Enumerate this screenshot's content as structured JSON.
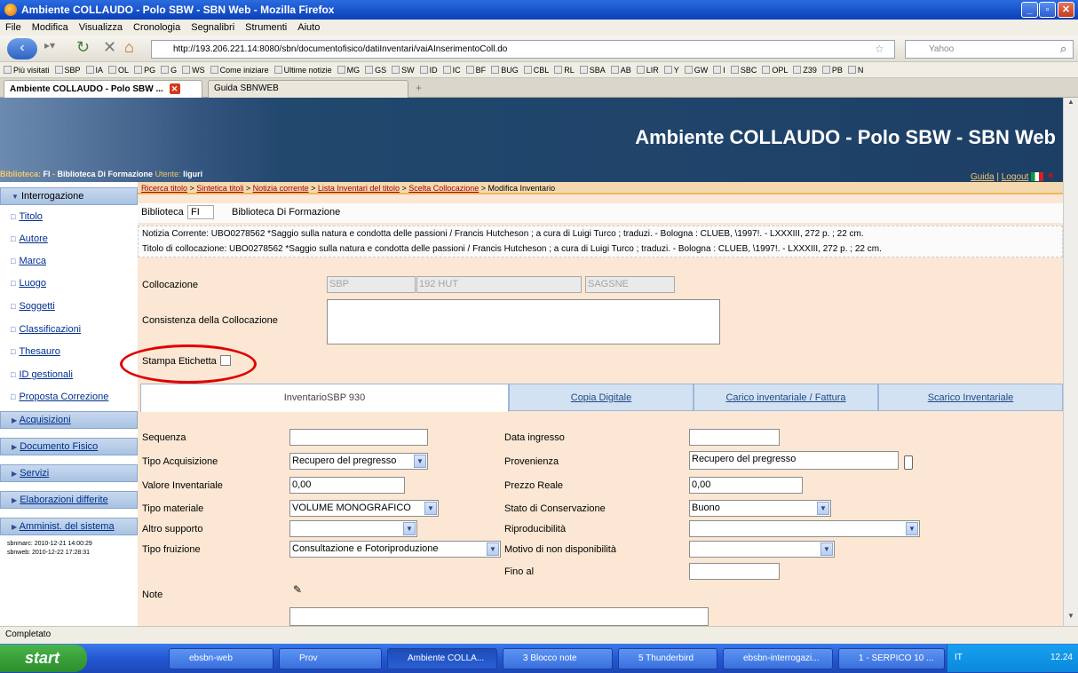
{
  "window": {
    "title": "Ambiente COLLAUDO - Polo SBW - SBN Web - Mozilla Firefox"
  },
  "menu": [
    "File",
    "Modifica",
    "Visualizza",
    "Cronologia",
    "Segnalibri",
    "Strumenti",
    "Aiuto"
  ],
  "nav": {
    "url": "http://193.206.221.14:8080/sbn/documentofisico/datiInventari/vaiAInserimentoColl.do",
    "search_placeholder": "Yahoo"
  },
  "bookmarks": [
    "Più visitati",
    "SBP",
    "IA",
    "OL",
    "PG",
    "G",
    "WS",
    "Come iniziare",
    "Ultime notizie",
    "MG",
    "GS",
    "SW",
    "ID",
    "IC",
    "BF",
    "BUG",
    "CBL",
    "RL",
    "SBA",
    "AB",
    "LIR",
    "Y",
    "GW",
    "I",
    "SBC",
    "OPL",
    "Z39",
    "PB",
    "N"
  ],
  "tabs": [
    {
      "label": "Ambiente COLLAUDO - Polo SBW ..."
    },
    {
      "label": "Guida SBNWEB"
    }
  ],
  "banner": {
    "title": "Ambiente COLLAUDO - Polo SBW - SBN Web",
    "biblioteca_label": "Biblioteca:",
    "biblioteca_code": "FI",
    "biblioteca_name": "Biblioteca Di Formazione",
    "utente_label": "Utente:",
    "utente": "liguri",
    "guida": "Guida",
    "logout": "Logout"
  },
  "breadcrumb": [
    "Ricerca titolo",
    "Sintetica titoli",
    "Notizia corrente",
    "Lista Inventari del titolo",
    "Scelta Collocazione",
    "Modifica Inventario"
  ],
  "sidebar": {
    "interrogazione": "Interrogazione",
    "items": [
      "Titolo",
      "Autore",
      "Marca",
      "Luogo",
      "Soggetti",
      "Classificazioni",
      "Thesauro",
      "ID gestionali",
      "Proposta Correzione"
    ],
    "sections": [
      "Acquisizioni",
      "Documento Fisico",
      "Servizi",
      "Elaborazioni differite",
      "Amminist. del sistema"
    ],
    "sbnmarc": "sbnmarc: 2010-12-21 14:00:29",
    "sbnweb": "sbnweb: 2010-12-22 17:28:31"
  },
  "header": {
    "biblioteca_label": "Biblioteca",
    "biblioteca_code": "FI",
    "biblioteca_name": "Biblioteca Di Formazione",
    "notizia": "Notizia Corrente: UBO0278562 *Saggio sulla natura e condotta delle passioni / Francis Hutcheson ; a cura di Luigi Turco ; traduzi. - Bologna : CLUEB, \\1997!. - LXXXIII, 272 p. ; 22 cm.",
    "titolo_coll": "Titolo di collocazione: UBO0278562 *Saggio sulla natura e condotta delle passioni / Francis Hutcheson ; a cura di Luigi Turco ; traduzi. - Bologna : CLUEB, \\1997!. - LXXXIII, 272 p. ; 22 cm."
  },
  "form": {
    "collocazione_label": "Collocazione",
    "coll1": "SBP",
    "coll2": "192 HUT",
    "coll3": "SAGSNE",
    "consistenza_label": "Consistenza della Collocazione",
    "stampa_label": "Stampa Etichetta",
    "tabs": [
      "InventarioSBP 930",
      "Copia Digitale",
      "Carico inventariale / Fattura",
      "Scarico Inventariale"
    ],
    "sequenza": "Sequenza",
    "tipo_acq": "Tipo Acquisizione",
    "tipo_acq_val": "Recupero del pregresso",
    "valore_inv": "Valore Inventariale",
    "valore_inv_val": "0,00",
    "tipo_mat": "Tipo materiale",
    "tipo_mat_val": "VOLUME MONOGRAFICO",
    "altro_supp": "Altro supporto",
    "tipo_fruiz": "Tipo fruizione",
    "tipo_fruiz_val": "Consultazione e Fotoriproduzione",
    "note": "Note",
    "data_ingresso": "Data ingresso",
    "provenienza": "Provenienza",
    "provenienza_val": "Recupero del pregresso",
    "prezzo_reale": "Prezzo Reale",
    "prezzo_reale_val": "0,00",
    "stato_cons": "Stato di Conservazione",
    "stato_cons_val": "Buono",
    "riproducibilita": "Riproducibilità",
    "motivo": "Motivo di non disponibilità",
    "fino_al": "Fino al"
  },
  "status": "Completato",
  "taskbar": {
    "start": "start",
    "items": [
      "ebsbn-web",
      "Prov",
      "Ambiente COLLA...",
      "3 Blocco note",
      "5 Thunderbird",
      "ebsbn-interrogazi...",
      "1 - SERPICO 10 ..."
    ],
    "lang": "IT",
    "clock": "12.24"
  }
}
